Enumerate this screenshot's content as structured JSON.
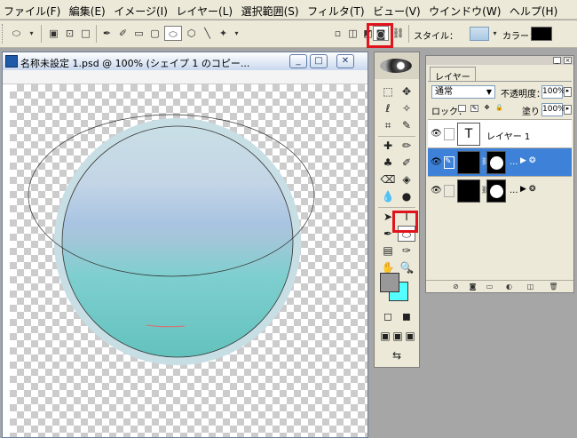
{
  "menu": [
    "ファイル(F)",
    "編集(E)",
    "イメージ(I)",
    "レイヤー(L)",
    "選択範囲(S)",
    "フィルタ(T)",
    "ビュー(V)",
    "ウインドウ(W)",
    "ヘルプ(H)"
  ],
  "options_bar": {
    "style_label": "スタイル：",
    "color_label": "カラー：",
    "color_value": "#000000",
    "highlight_color": "#e0141c"
  },
  "document": {
    "title": "名称未設定 1.psd @ 100% (シェイプ 1 のコピー...",
    "minimize": "_",
    "maximize": "□",
    "close": "✕"
  },
  "toolbox": {
    "foreground_color": "#999999",
    "background_color": "#55ffff",
    "active_tool": "ellipse-tool"
  },
  "layers_panel": {
    "tab_label": "レイヤー",
    "blend_mode": "通常",
    "opacity_label": "不透明度：",
    "opacity_value": "100%",
    "lock_label": "ロック：",
    "fill_label": "塗り：",
    "fill_value": "100%",
    "layers": [
      {
        "name": "レイヤー 1",
        "type": "text"
      },
      {
        "name": "...",
        "type": "shape",
        "selected": true
      },
      {
        "name": "...",
        "type": "shape",
        "selected": false
      }
    ]
  }
}
